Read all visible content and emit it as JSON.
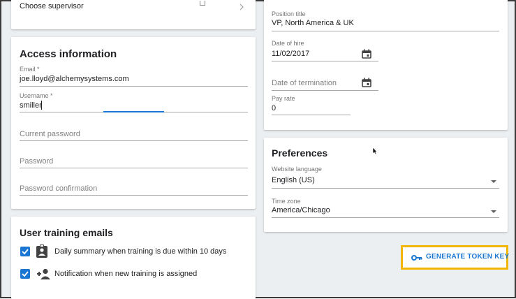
{
  "supervisor": {
    "label": "Choose supervisor"
  },
  "access": {
    "title": "Access information",
    "email_label": "Email *",
    "email_value": "joe.lloyd@alchemysystems.com",
    "username_label": "Username *",
    "username_value": "smiller",
    "current_password_placeholder": "Current password",
    "password_placeholder": "Password",
    "password_confirm_placeholder": "Password confirmation"
  },
  "training": {
    "title": "User training emails",
    "daily_label": "Daily summary when training is due within 10 days",
    "notify_label": "Notification when new training is assigned"
  },
  "job": {
    "position_label": "Position title",
    "position_value": "VP, North America & UK",
    "hire_label": "Date of hire",
    "hire_value": "11/02/2017",
    "termination_placeholder": "Date of termination",
    "pay_label": "Pay rate",
    "pay_value": "0"
  },
  "preferences": {
    "title": "Preferences",
    "language_label": "Website language",
    "language_value": "English (US)",
    "timezone_label": "Time zone",
    "timezone_value": "America/Chicago"
  },
  "token_button": {
    "label": "GENERATE TOKEN KEY"
  },
  "colors": {
    "accent": "#1976d2",
    "highlight": "#f2b705",
    "background": "#eceff1"
  }
}
